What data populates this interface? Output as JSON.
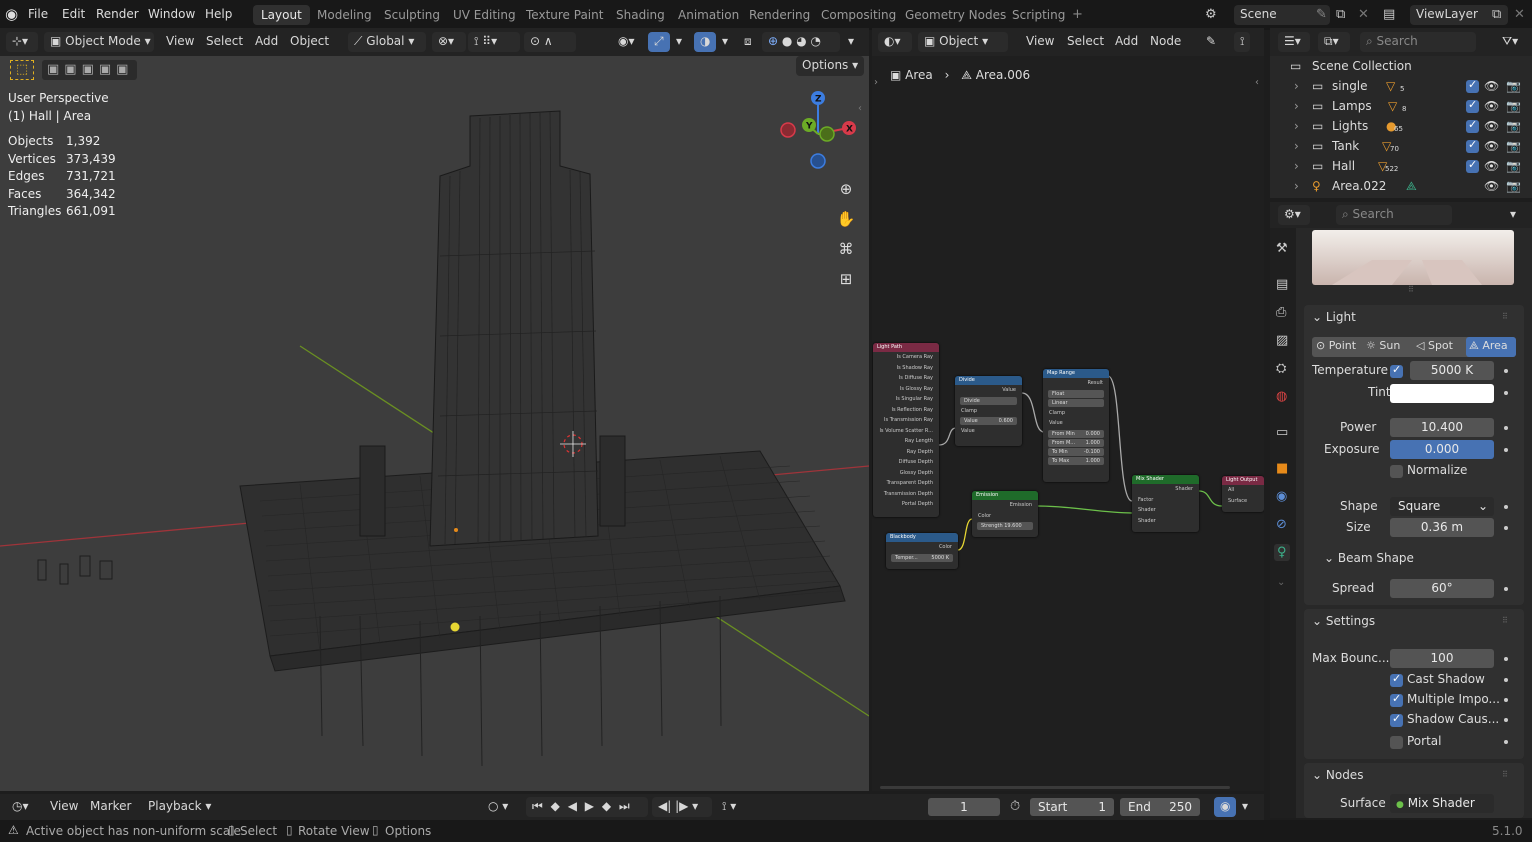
{
  "menu": {
    "file": "File",
    "edit": "Edit",
    "render": "Render",
    "window": "Window",
    "help": "Help"
  },
  "workspaces": [
    "Layout",
    "Modeling",
    "Sculpting",
    "UV Editing",
    "Texture Paint",
    "Shading",
    "Animation",
    "Rendering",
    "Compositing",
    "Geometry Nodes",
    "Scripting"
  ],
  "scene": {
    "label": "Scene",
    "viewlayer": "ViewLayer"
  },
  "viewport": {
    "mode": "Object Mode",
    "view": "View",
    "select": "Select",
    "add": "Add",
    "object": "Object",
    "transform": "Global",
    "options": "Options",
    "perspective": "User Perspective",
    "context": "(1) Hall | Area",
    "stats": [
      {
        "label": "Objects",
        "value": "1,392"
      },
      {
        "label": "Vertices",
        "value": "373,439"
      },
      {
        "label": "Edges",
        "value": "731,721"
      },
      {
        "label": "Faces",
        "value": "364,342"
      },
      {
        "label": "Triangles",
        "value": "661,091"
      }
    ],
    "gizmo": {
      "z": "Z",
      "y": "Y",
      "x": "X"
    }
  },
  "node_editor": {
    "type": "Object",
    "view": "View",
    "select": "Select",
    "add": "Add",
    "node": "Node",
    "breadcrumb": [
      "Area",
      "Area.006"
    ],
    "nodes": {
      "light_path": {
        "title": "Light Path",
        "outputs": [
          "Is Camera Ray",
          "Is Shadow Ray",
          "Is Diffuse Ray",
          "Is Glossy Ray",
          "Is Singular Ray",
          "Is Reflection Ray",
          "Is Transmission Ray",
          "Is Volume Scatter R...",
          "Ray Length",
          "Ray Depth",
          "Diffuse Depth",
          "Glossy Depth",
          "Transparent Depth",
          "Transmission Depth",
          "Portal Depth"
        ]
      },
      "divide": {
        "title": "Divide",
        "out": "Value",
        "op": "Divide",
        "clamp": "Clamp",
        "value_label": "Value",
        "value": "0.600",
        "in": "Value"
      },
      "map_range": {
        "title": "Map Range",
        "out": "Result",
        "type": "Float",
        "interp": "Linear",
        "clamp": "Clamp",
        "in": "Value",
        "fields": [
          {
            "l": "From Min",
            "v": "0.000"
          },
          {
            "l": "From M...",
            "v": "1.000"
          },
          {
            "l": "To Min",
            "v": "-0.100"
          },
          {
            "l": "To Max",
            "v": "1.000"
          }
        ]
      },
      "emission": {
        "title": "Emission",
        "out": "Emission",
        "color": "Color",
        "strength_label": "Strength",
        "strength": "19.600"
      },
      "blackbody": {
        "title": "Blackbody",
        "out": "Color",
        "temp_label": "Temper...",
        "temp": "5000 K"
      },
      "mix_shader": {
        "title": "Mix Shader",
        "out": "Shader",
        "inputs": [
          "Factor",
          "Shader",
          "Shader"
        ]
      },
      "output": {
        "title": "Light Output",
        "target": "All",
        "in": "Surface"
      }
    }
  },
  "outliner": {
    "search_placeholder": "Search",
    "root": "Scene Collection",
    "items": [
      {
        "name": "single",
        "count": "5"
      },
      {
        "name": "Lamps",
        "count": "8"
      },
      {
        "name": "Lights",
        "count": "65"
      },
      {
        "name": "Tank",
        "count": "70"
      },
      {
        "name": "Hall",
        "count": "522"
      },
      {
        "name": "Area.022",
        "count": ""
      }
    ]
  },
  "properties": {
    "search_placeholder": "Search",
    "light_panel": "Light",
    "light_types": [
      "Point",
      "Sun",
      "Spot",
      "Area"
    ],
    "active_type": "Area",
    "temperature_label": "Temperature",
    "temperature": "5000 K",
    "tint_label": "Tint",
    "power_label": "Power",
    "power": "10.400",
    "exposure_label": "Exposure",
    "exposure": "0.000",
    "normalize": "Normalize",
    "shape_label": "Shape",
    "shape": "Square",
    "size_label": "Size",
    "size": "0.36 m",
    "beam_shape": "Beam Shape",
    "spread_label": "Spread",
    "spread": "60°",
    "settings_panel": "Settings",
    "max_bounces_label": "Max Bounc...",
    "max_bounces": "100",
    "cast_shadow": "Cast Shadow",
    "multiple_importance": "Multiple Impo...",
    "shadow_caustics": "Shadow Caus...",
    "portal": "Portal",
    "nodes_panel": "Nodes",
    "surface_label": "Surface",
    "surface": "Mix Shader"
  },
  "timeline": {
    "view": "View",
    "marker": "Marker",
    "playback": "Playback",
    "current_frame": "1",
    "start_label": "Start",
    "start": "1",
    "end_label": "End",
    "end": "250"
  },
  "status": {
    "warning": "Active object has non-uniform scale",
    "select": "Select",
    "rotate": "Rotate View",
    "options": "Options",
    "version": "5.1.0"
  }
}
